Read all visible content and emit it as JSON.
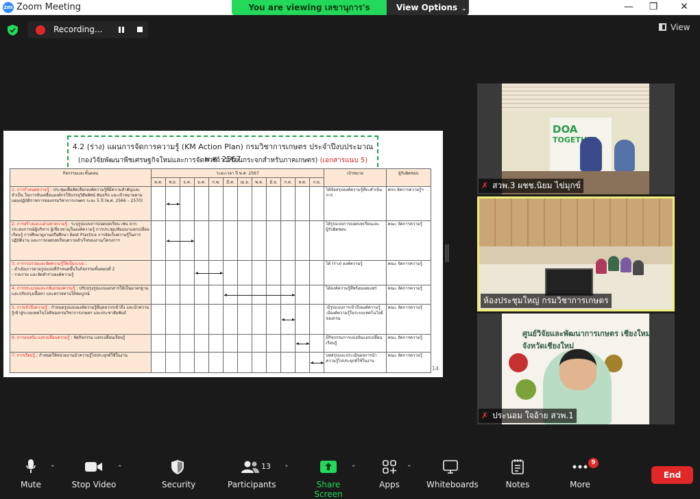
{
  "window": {
    "app_icon": "zm",
    "title": "Zoom Meeting"
  },
  "share_banner": {
    "message": "You are viewing เลขานุการ's screen",
    "view_options": "View Options"
  },
  "recording": {
    "label": "Recording..."
  },
  "view_button": {
    "label": "View"
  },
  "shared_doc": {
    "title": "4.2 (ร่าง) แผนการจัดการความรู้ (KM Action Plan) กรมวิชาการเกษตร ประจำปีงบประมาณ  พ.ศ. 2567",
    "subtitle": "(กองวิจัยพัฒนาพืชเศรษฐกิจใหม่และการจัดการก้าวเรือนกระจกสำหรับภาคเกษตร)",
    "subtitle_note": "(เอกสารแนบ 5)",
    "header_activity": "กิจกรรมและขั้นตอน",
    "header_year": "ระยะเวลา ปี พ.ศ. 2567",
    "header_goal": "เป้าหมาย",
    "header_resp": "ผู้รับผิดชอบ",
    "months": [
      "ต.ค.",
      "พ.ย.",
      "ธ.ค.",
      "ม.ค.",
      "ก.พ.",
      "มี.ค.",
      "เม.ย.",
      "พ.ค.",
      "มิ.ย.",
      "ก.ค.",
      "ส.ค.",
      "ก.ย."
    ],
    "rows": [
      {
        "label": "1. การกำหนดความรู้",
        "text": " : ประชุมเพื่อคัดเลือกองค์ความรู้ที่มีความสำคัญและจำเป็น ในการขับเคลื่อนองค์กรให้บรรลุวิสัยทัศน์ พันธกิจ และเป้าหมายตามแผนปฏิบัติราชการของกรมวิชาการเกษตร ระยะ 5 ปี (พ.ศ. 2566 – 2570)",
        "goal": "ได้ข้อสรุปองค์ความรู้ที่จะดำเนินการ",
        "resp": "คกก.จัดการความรู้ฯ"
      },
      {
        "label": "2. การสร้างและแสวงหาความรู้",
        "text": " : ระบุรูปแบบการถอดบทเรียน เช่น จากประสบการณ์ผู้บริหาร ผู้เชี่ยวชาญในองค์ความรู้ การประชุม/สัมมนาแลกเปลี่ยนเรียนรู้ การศึกษาดูงานหรือศึกษา Best Practice การจัดเก็บความรู้ในการปฏิบัติงาน และการถอดบทเรียนความสำเร็จของงาน/โครงการ",
        "goal": "ได้รูปแบบการถอดบทเรียนและผู้รับผิดชอบ",
        "resp": "คณะ จัดการความรู้"
      },
      {
        "label": "3. การรวบรวมและจัดความรู้ให้เป็นระบบ",
        "text": " :\n - ดำเนินการตามรูปแบบที่กำหนดขึ้นในกิจกรรมขั้นตอนที่ 2\n - รวบรวม และจัดทำร่างองค์ความรู้",
        "goal": "ได้ (ร่าง) องค์ความรู้",
        "resp": "คณะ จัดการความรู้"
      },
      {
        "label": "4. การประมวลและกลั่นกรองความรู้",
        "text": " : ปรับปรุงรูปแบบเอกสารให้เป็นมาตรฐาน และปรับปรุงเนื้อหา และตรวจทานให้สมบูรณ์",
        "goal": "ได้องค์ความรู้ที่พร้อมเผยแพร่",
        "resp": "คณะ จัดการความรู้"
      },
      {
        "label": "5. การเข้าถึงความรู้",
        "text": " : กำหนดรูปแบบองค์ความรู้ที่บุคลากรเข้าถึง และนำความรู้เข้าสู่ระบบเทคโนโลยีของกรมวิชาการเกษตร และประชาสัมพันธ์",
        "goal": "-มีรูปแบบการเข้าถึงองค์ความรู้\n-มีองค์ความรู้ในระบบเทคโนโลยีของกรม",
        "resp": "คณะ จัดการความรู้"
      },
      {
        "label": "6. การแบ่งปัน แลกเปลี่ยนความรู้",
        "text": " : จัดกิจกรรม แลกเปลี่ยนเรียนรู้",
        "goal": "มีกิจกรรมการแบ่งปันแลกเปลี่ยนเรียนรู้",
        "resp": "คณะ จัดการความรู้"
      },
      {
        "label": "7. การเรียนรู้",
        "text": " : กำหนดให้หน่วยงานนำความรู้ไปประยุกต์ใช้ในงาน",
        "goal": "บทสรุปและประเมินผลการนำความรู้ไปประยุกต์ใช้ในงาน",
        "resp": "คณะ จัดการความรู้"
      }
    ],
    "timeline_months": [
      [
        1,
        1
      ],
      [
        1,
        2
      ],
      [
        3,
        4
      ],
      [
        5,
        9
      ],
      [
        9,
        9
      ],
      [
        10,
        10
      ],
      [
        11,
        11
      ]
    ],
    "page_number": "14"
  },
  "participants": [
    {
      "name": "สวพ.3 ผชช.นิยม ไข่มุกข์",
      "muted": true,
      "banner_text_1": "DOA",
      "banner_text_2": "TOGETHER"
    },
    {
      "name": "ห้องประชุมใหญ่ กรมวิชาการเกษตร",
      "muted": false,
      "active_speaker": true
    },
    {
      "name": "ประนอม ใจอ้าย สวพ.1",
      "muted": true,
      "backdrop_text": "ศูนย์วิจัยและพัฒนาการเกษตร เชียงใหม่ จังหวัดเชียงใหม่"
    }
  ],
  "toolbar": {
    "mute": "Mute",
    "stop_video": "Stop Video",
    "security": "Security",
    "participants": "Participants",
    "participant_count": "13",
    "share_screen": "Share Screen",
    "apps": "Apps",
    "whiteboards": "Whiteboards",
    "notes": "Notes",
    "more": "More",
    "more_badge": "9",
    "end": "End"
  },
  "colors": {
    "share_green": "#23d959",
    "end_red": "#e02828",
    "active_border": "#eef07a"
  }
}
